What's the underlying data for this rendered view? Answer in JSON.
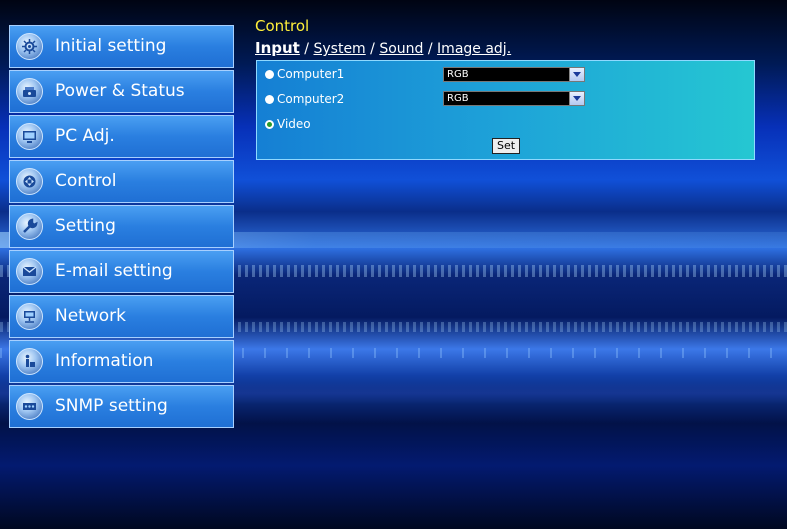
{
  "sidebar": {
    "items": [
      {
        "label": "Initial setting",
        "icon": "gear-icon"
      },
      {
        "label": "Power & Status",
        "icon": "power-icon"
      },
      {
        "label": "PC Adj.",
        "icon": "monitor-icon"
      },
      {
        "label": "Control",
        "icon": "joystick-icon"
      },
      {
        "label": "Setting",
        "icon": "wrench-icon"
      },
      {
        "label": "E-mail setting",
        "icon": "envelope-icon"
      },
      {
        "label": "Network",
        "icon": "network-icon"
      },
      {
        "label": "Information",
        "icon": "info-icon"
      },
      {
        "label": "SNMP setting",
        "icon": "snmp-icon"
      }
    ]
  },
  "main": {
    "title": "Control",
    "tabs": [
      {
        "label": "Input",
        "active": true
      },
      {
        "label": "System",
        "active": false
      },
      {
        "label": "Sound",
        "active": false
      },
      {
        "label": "Image adj.",
        "active": false
      }
    ],
    "separator": " / ",
    "inputs": [
      {
        "label": "Computer1",
        "selected": false,
        "select_value": "RGB"
      },
      {
        "label": "Computer2",
        "selected": false,
        "select_value": "RGB"
      },
      {
        "label": "Video",
        "selected": true
      }
    ],
    "set_label": "Set"
  },
  "colors": {
    "title": "#ffef3a",
    "panel": "#1ea3d8",
    "nav": "#2a7fe0"
  }
}
